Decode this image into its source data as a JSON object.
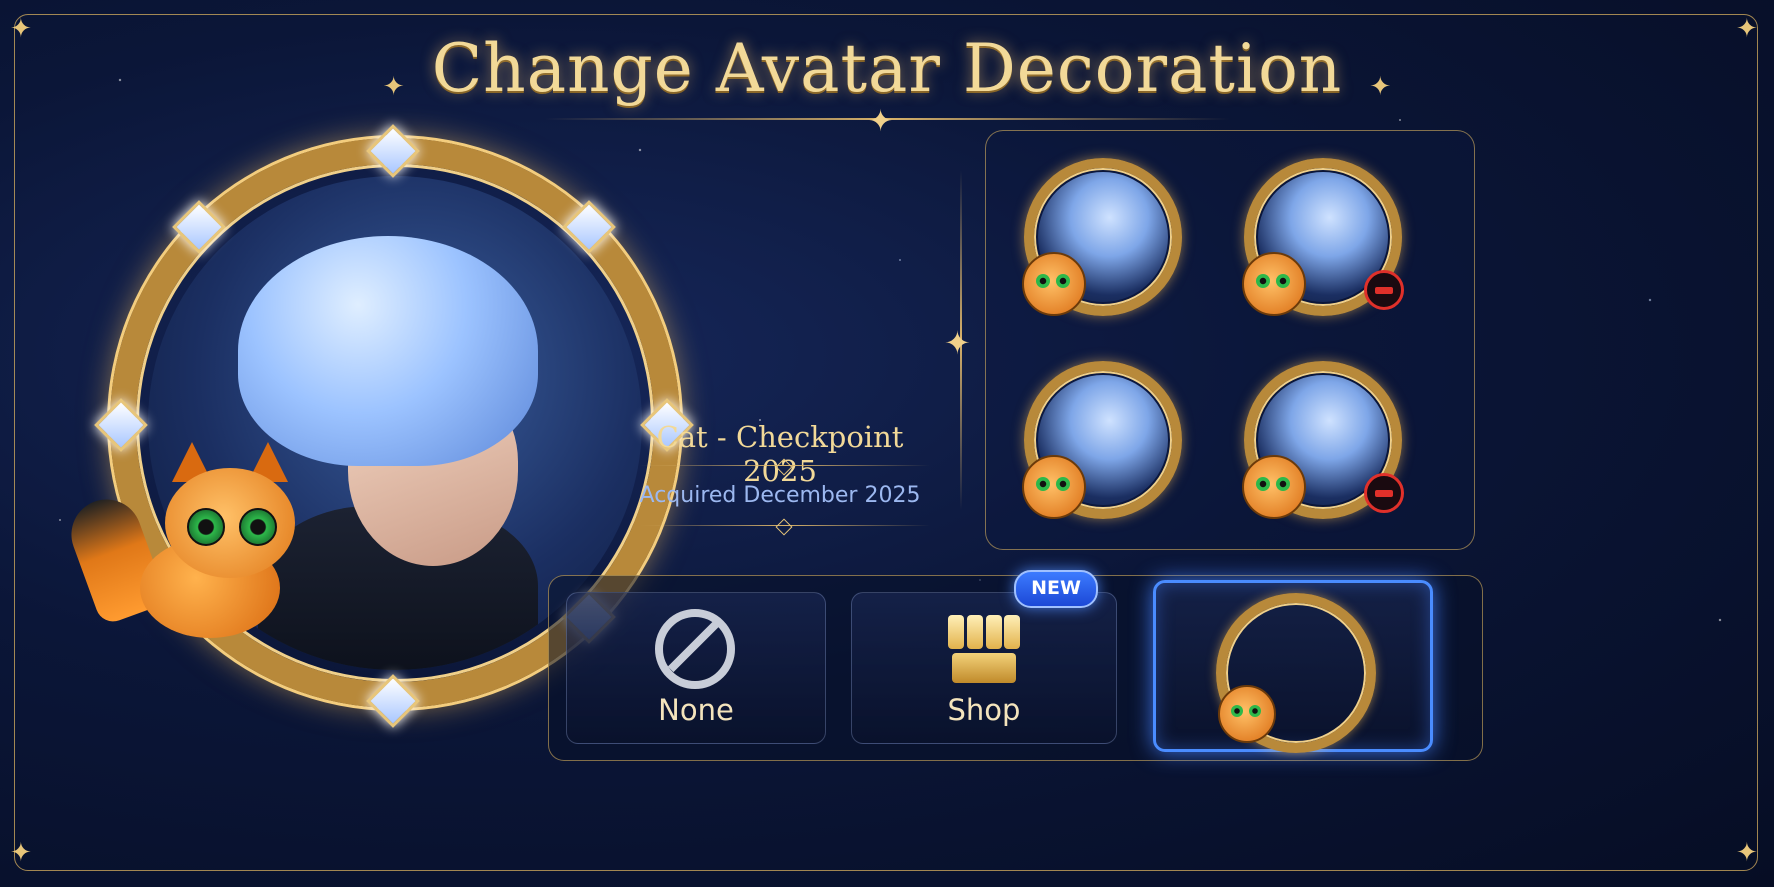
{
  "header": {
    "title": "Change Avatar Decoration"
  },
  "preview": {
    "decoration_name": "Cat - Checkpoint 2025",
    "acquired_text": "Acquired December 2025"
  },
  "decorations_grid": [
    {
      "name": "cat-decoration",
      "removable": false
    },
    {
      "name": "cat-decoration",
      "removable": true
    },
    {
      "name": "cat-decoration",
      "removable": false
    },
    {
      "name": "cat-decoration",
      "removable": true
    }
  ],
  "options": {
    "none_label": "None",
    "shop_label": "Shop",
    "new_badge": "NEW"
  },
  "colors": {
    "gold": "#e8c67a",
    "selected_blue": "#4a8cff",
    "remove_red": "#e0302a",
    "background": "#0b1638"
  },
  "icons": [
    "sparkle-icon",
    "prohibited-icon",
    "shop-icon",
    "minus-icon"
  ]
}
